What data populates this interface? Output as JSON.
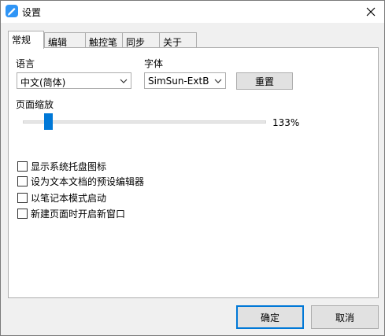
{
  "window": {
    "title": "设置"
  },
  "tabs": [
    {
      "label": "常规",
      "active": true
    },
    {
      "label": "编辑",
      "active": false
    },
    {
      "label": "触控笔",
      "active": false
    },
    {
      "label": "同步",
      "active": false
    },
    {
      "label": "关于",
      "active": false
    }
  ],
  "general": {
    "language_label": "语言",
    "language_value": "中文(简体)",
    "font_label": "字体",
    "font_value": "SimSun-ExtB",
    "reset_label": "重置",
    "zoom_label": "页面缩放",
    "zoom_value": "133%",
    "zoom_fraction": 0.09,
    "checkboxes": [
      {
        "label": "显示系统托盘图标",
        "checked": false
      },
      {
        "label": "设为文本文档的预设编辑器",
        "checked": false
      },
      {
        "label": "以笔记本模式启动",
        "checked": false
      },
      {
        "label": "新建页面时开启新窗口",
        "checked": false
      }
    ]
  },
  "footer": {
    "ok_label": "确定",
    "cancel_label": "取消"
  },
  "colors": {
    "accent": "#0078d7",
    "app_icon": "#2f95f6"
  },
  "icons": {
    "app": "notebook-app-icon",
    "close": "close-icon",
    "dropdown": "chevron-down-icon"
  }
}
